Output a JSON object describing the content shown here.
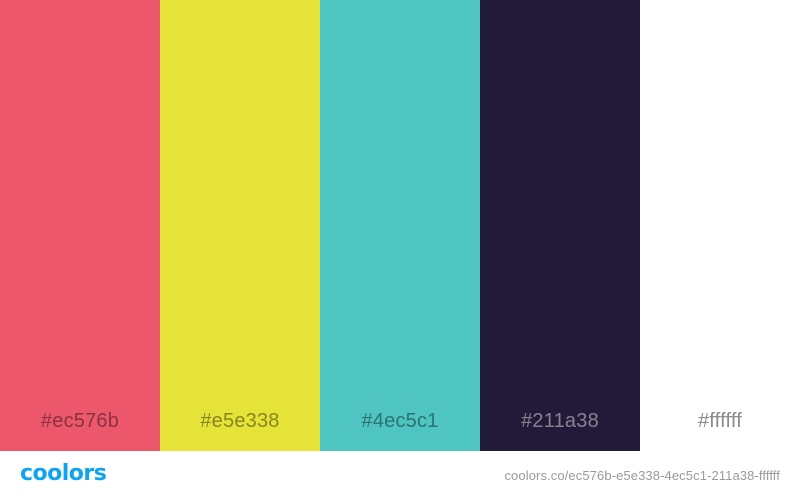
{
  "palette": {
    "swatches": [
      {
        "hex": "#ec576b",
        "label": "#ec576b"
      },
      {
        "hex": "#e5e338",
        "label": "#e5e338"
      },
      {
        "hex": "#4ec5c1",
        "label": "#4ec5c1"
      },
      {
        "hex": "#211a38",
        "label": "#211a38"
      },
      {
        "hex": "#ffffff",
        "label": "#ffffff"
      }
    ]
  },
  "footer": {
    "logo_text": "coolors",
    "logo_color": "#0fa3f0",
    "url": "coolors.co/ec576b-e5e338-4ec5c1-211a38-ffffff"
  }
}
